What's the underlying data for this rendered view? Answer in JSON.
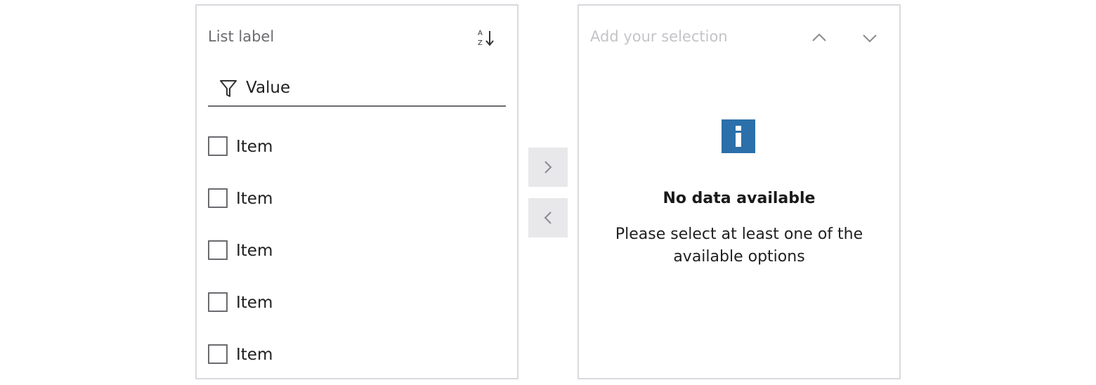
{
  "source_list": {
    "label": "List label",
    "sort_icon": "sort-az-icon",
    "filter": {
      "icon": "filter-icon",
      "placeholder": "Value",
      "value": ""
    },
    "items": [
      {
        "label": "Item",
        "checked": false
      },
      {
        "label": "Item",
        "checked": false
      },
      {
        "label": "Item",
        "checked": false
      },
      {
        "label": "Item",
        "checked": false
      },
      {
        "label": "Item",
        "checked": false
      }
    ]
  },
  "transfer": {
    "move_right_icon": "chevron-right-icon",
    "move_left_icon": "chevron-left-icon"
  },
  "selection_list": {
    "label": "Add your selection",
    "move_up_icon": "chevron-up-icon",
    "move_down_icon": "chevron-down-icon",
    "empty_state": {
      "icon": "info-icon",
      "title": "No data available",
      "message": "Please select at least one of the available options"
    }
  },
  "colors": {
    "accent": "#2b70aa",
    "border": "#d9d9de",
    "button_bg": "#e8e8eb",
    "muted_text": "#c4c4c8"
  }
}
